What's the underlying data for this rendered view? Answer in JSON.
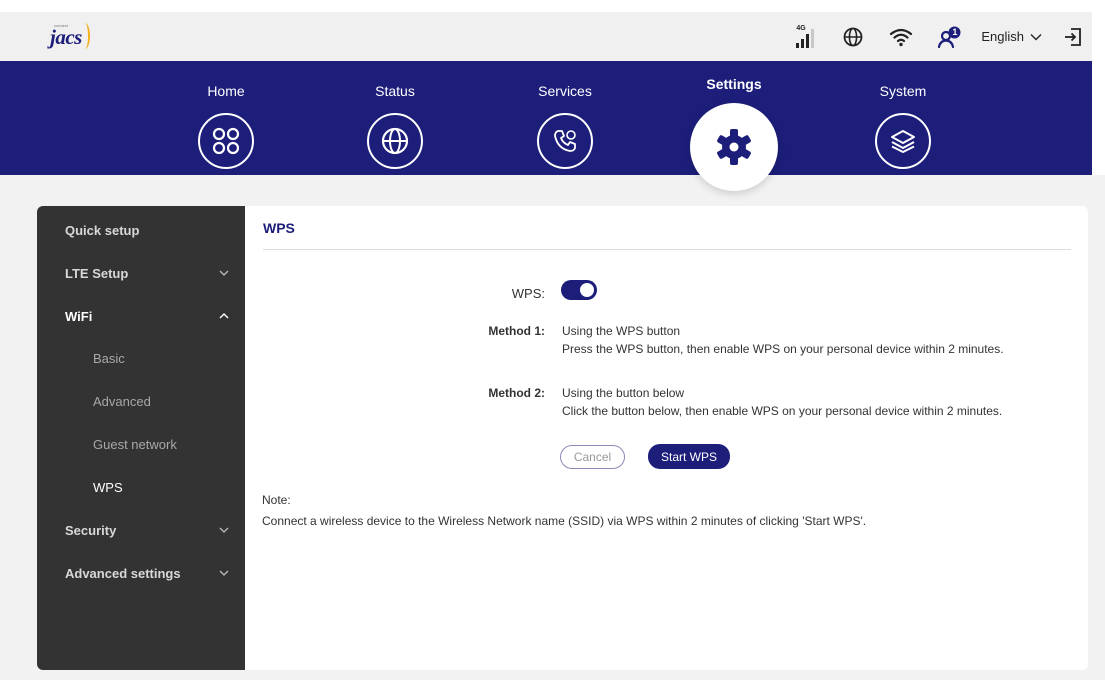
{
  "brand": {
    "name": "jacs",
    "tagline": "connect"
  },
  "header": {
    "network_type": "4G",
    "language": "English",
    "notification_count": "1",
    "icons": [
      "signal-icon",
      "globe-icon",
      "wifi-icon",
      "user-notification-icon",
      "chevron-down-icon",
      "logout-icon"
    ]
  },
  "nav": {
    "items": [
      {
        "label": "Home",
        "icon": "home-grid-icon"
      },
      {
        "label": "Status",
        "icon": "globe-icon"
      },
      {
        "label": "Services",
        "icon": "phone-icon"
      },
      {
        "label": "Settings",
        "icon": "settings-gear-icon",
        "active": true
      },
      {
        "label": "System",
        "icon": "layers-icon"
      }
    ]
  },
  "sidebar": {
    "items": [
      {
        "label": "Quick setup"
      },
      {
        "label": "LTE Setup"
      },
      {
        "label": "WiFi",
        "expanded": true
      },
      {
        "label": "Basic"
      },
      {
        "label": "Advanced"
      },
      {
        "label": "Guest network"
      },
      {
        "label": "WPS",
        "current": true
      },
      {
        "label": "Security"
      },
      {
        "label": "Advanced settings"
      }
    ]
  },
  "panel": {
    "title": "WPS",
    "wps_label": "WPS:",
    "wps_enabled": true,
    "method1": {
      "label": "Method 1:",
      "line1": "Using the WPS button",
      "line2": "Press the WPS button, then enable WPS on your personal device within 2 minutes."
    },
    "method2": {
      "label": "Method 2:",
      "line1": "Using the button below",
      "line2": "Click the button below, then enable WPS on your personal device within 2 minutes."
    },
    "cancel_label": "Cancel",
    "start_label": "Start WPS",
    "note_label": "Note:",
    "note_text": "Connect a wireless device to the Wireless Network name (SSID) via WPS within 2 minutes of clicking 'Start WPS'."
  },
  "colors": {
    "primary": "#1c1e7a",
    "accent": "#f2b01e",
    "sidebar": "#333333",
    "background": "#f2f2f2"
  }
}
